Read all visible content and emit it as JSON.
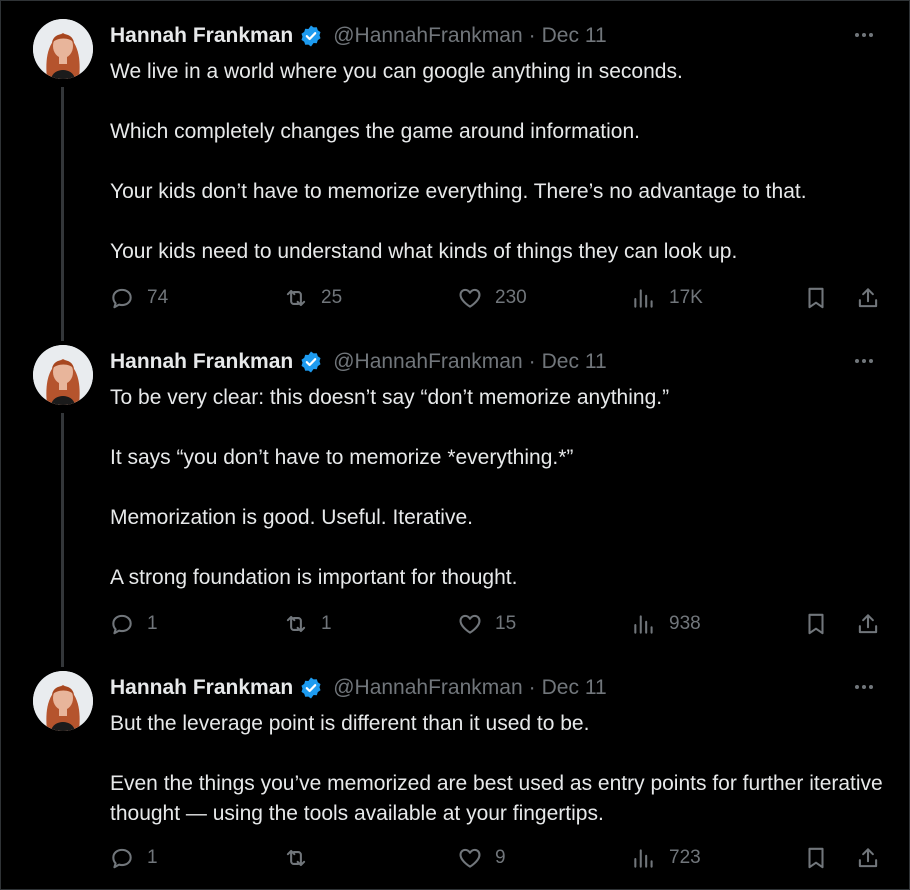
{
  "colors": {
    "background": "#000000",
    "text": "#e7e9ea",
    "muted": "#71767b",
    "verified": "#1d9bf0"
  },
  "tweets": [
    {
      "author": {
        "name": "Hannah Frankman",
        "handle": "@HannahFrankman",
        "verified": true
      },
      "date": "Dec 11",
      "paragraphs": [
        "We live in a world where you can google anything in seconds.",
        "Which completely changes the game around information.",
        "Your kids don’t have to memorize everything. There’s no advantage to that.",
        "Your kids need to understand what kinds of things they can look up."
      ],
      "stats": {
        "replies": "74",
        "reposts": "25",
        "likes": "230",
        "views": "17K"
      }
    },
    {
      "author": {
        "name": "Hannah Frankman",
        "handle": "@HannahFrankman",
        "verified": true
      },
      "date": "Dec 11",
      "paragraphs": [
        "To be very clear: this doesn’t say “don’t memorize anything.”",
        "It says “you don’t have to memorize *everything.*”",
        "Memorization is good. Useful. Iterative.",
        "A strong foundation is important for thought."
      ],
      "stats": {
        "replies": "1",
        "reposts": "1",
        "likes": "15",
        "views": "938"
      }
    },
    {
      "author": {
        "name": "Hannah Frankman",
        "handle": "@HannahFrankman",
        "verified": true
      },
      "date": "Dec 11",
      "paragraphs": [
        "But the leverage point is different than it used to be.",
        "Even the things you’ve memorized are best used as entry points for further iterative thought — using the tools available at your fingertips."
      ],
      "stats": {
        "replies": "1",
        "reposts": "",
        "likes": "9",
        "views": "723"
      }
    }
  ],
  "icons": {
    "reply": "reply-icon",
    "repost": "repost-icon",
    "like": "heart-icon",
    "views": "views-icon",
    "bookmark": "bookmark-icon",
    "share": "share-icon",
    "more": "more-icon",
    "verified": "verified-badge-icon"
  }
}
